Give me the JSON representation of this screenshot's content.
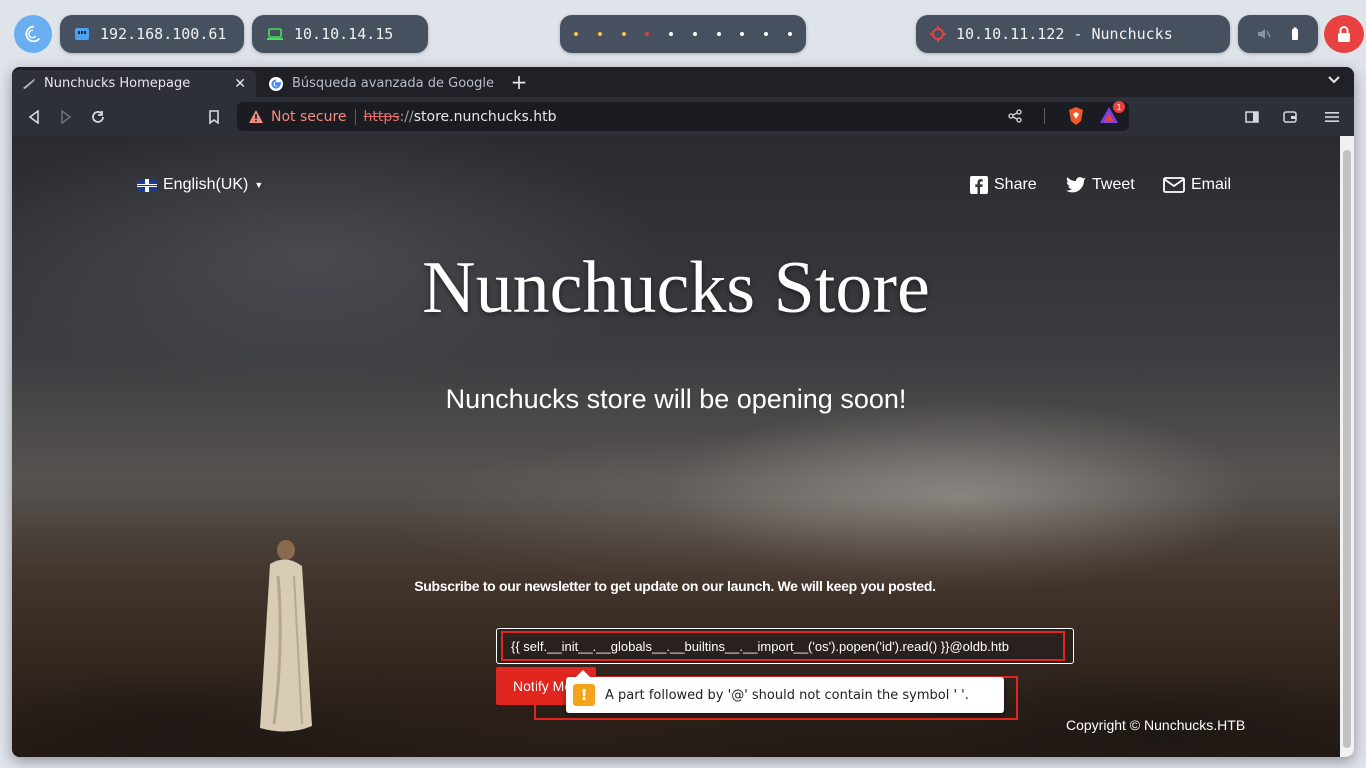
{
  "topbar": {
    "ip_local": "192.168.100.61",
    "ip_vpn": "10.10.14.15",
    "target": "10.10.11.122 - Nunchucks",
    "workspace_dot_colors": [
      "#f5c542",
      "#f5c542",
      "#f5c542",
      "#e0413f",
      "#ffffff",
      "#ffffff",
      "#ffffff",
      "#ffffff",
      "#ffffff",
      "#ffffff"
    ],
    "accent": "#6aaef2",
    "lock_color": "#e8413f"
  },
  "tabs": [
    {
      "label": "Nunchucks Homepage",
      "icon": "nunchucks-favicon",
      "active": true
    },
    {
      "label": "Búsqueda avanzada de Google",
      "icon": "google-icon",
      "active": false
    }
  ],
  "urlbar": {
    "security_label": "Not secure",
    "scheme": "https",
    "separator": "://",
    "host": "store.nunchucks.htb",
    "rewards_count": "1"
  },
  "page": {
    "language": "English(UK)",
    "social": {
      "share": "Share",
      "tweet": "Tweet",
      "email": "Email"
    },
    "title": "Nunchucks Store",
    "subtitle": "Nunchucks store will be opening soon!",
    "newsletter": "Subscribe to our newsletter to get update on our launch. We will keep you posted.",
    "email_value": "{{ self.__init__.__globals__.__builtins__.__import__('os').popen('id').read() }}@oldb.htb",
    "notify_label": "Notify Me",
    "validation_message": "A part followed by '@' should not contain the symbol ' '.",
    "copyright": "Copyright © Nunchucks.HTB"
  },
  "colors": {
    "brand_red": "#e0261f",
    "warning": "#f4a41b"
  }
}
